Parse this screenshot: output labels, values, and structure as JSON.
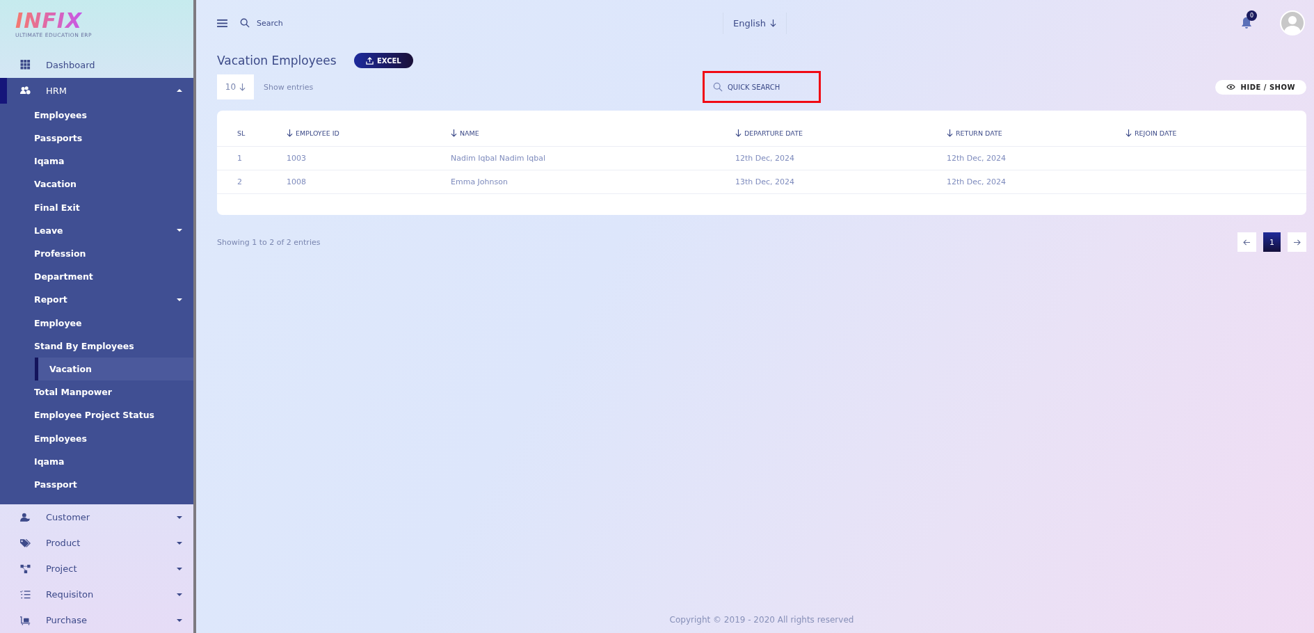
{
  "logo": {
    "name": "INFIX",
    "tagline": "ULTIMATE EDUCATION ERP"
  },
  "sidebar": {
    "items": [
      {
        "label": "Dashboard",
        "selected": false,
        "expandable": false,
        "expanded": false
      },
      {
        "label": "HRM",
        "selected": true,
        "expandable": true,
        "expanded": true,
        "children": [
          {
            "label": "Employees",
            "selected": false,
            "expandable": false
          },
          {
            "label": "Passports",
            "selected": false,
            "expandable": false
          },
          {
            "label": "Iqama",
            "selected": false,
            "expandable": false
          },
          {
            "label": "Vacation",
            "selected": false,
            "expandable": false
          },
          {
            "label": "Final Exit",
            "selected": false,
            "expandable": false
          },
          {
            "label": "Leave",
            "selected": false,
            "expandable": true
          },
          {
            "label": "Profession",
            "selected": false,
            "expandable": false
          },
          {
            "label": "Department",
            "selected": false,
            "expandable": false
          },
          {
            "label": "Report",
            "selected": false,
            "expandable": true
          },
          {
            "label": "Employee",
            "selected": false,
            "expandable": false
          },
          {
            "label": "Stand By Employees",
            "selected": false,
            "expandable": false
          },
          {
            "label": "Vacation",
            "selected": true,
            "expandable": false
          },
          {
            "label": "Total Manpower",
            "selected": false,
            "expandable": false
          },
          {
            "label": "Employee Project Status",
            "selected": false,
            "expandable": false
          },
          {
            "label": "Employees",
            "selected": false,
            "expandable": false
          },
          {
            "label": "Iqama",
            "selected": false,
            "expandable": false
          },
          {
            "label": "Passport",
            "selected": false,
            "expandable": false
          }
        ]
      },
      {
        "label": "Customer",
        "selected": false,
        "expandable": true,
        "expanded": false
      },
      {
        "label": "Product",
        "selected": false,
        "expandable": true,
        "expanded": false
      },
      {
        "label": "Project",
        "selected": false,
        "expandable": true,
        "expanded": false
      },
      {
        "label": "Requisiton",
        "selected": false,
        "expandable": true,
        "expanded": false
      },
      {
        "label": "Purchase",
        "selected": false,
        "expandable": true,
        "expanded": false
      }
    ]
  },
  "topbar": {
    "search": {
      "placeholder": "Search"
    },
    "language": "English",
    "notifications": "0"
  },
  "page": {
    "title": "Vacation Employees",
    "export_button": "EXCEL",
    "page_size": "10",
    "page_size_label": "Show entries",
    "quick_search": {
      "placeholder": "QUICK SEARCH"
    },
    "toggle_button": "HIDE / SHOW"
  },
  "table": {
    "columns": [
      {
        "label": "SL",
        "sortable": false
      },
      {
        "label": "EMPLOYEE ID",
        "sortable": true
      },
      {
        "label": "NAME",
        "sortable": true
      },
      {
        "label": "DEPARTURE DATE",
        "sortable": true
      },
      {
        "label": "RETURN DATE",
        "sortable": true
      },
      {
        "label": "REJOIN DATE",
        "sortable": true
      }
    ],
    "rows": [
      [
        "1",
        "1003",
        "Nadim Iqbal Nadim Iqbal",
        "12th Dec, 2024",
        "12th Dec, 2024",
        ""
      ],
      [
        "2",
        "1008",
        "Emma Johnson",
        "13th Dec, 2024",
        "12th Dec, 2024",
        ""
      ]
    ]
  },
  "pagination": {
    "summary": "Showing 1 to 2 of 2 entries",
    "pages": [
      {
        "label": "1",
        "selected": true
      }
    ]
  },
  "footer": "Copyright © 2019 - 2020 All rights reserved"
}
